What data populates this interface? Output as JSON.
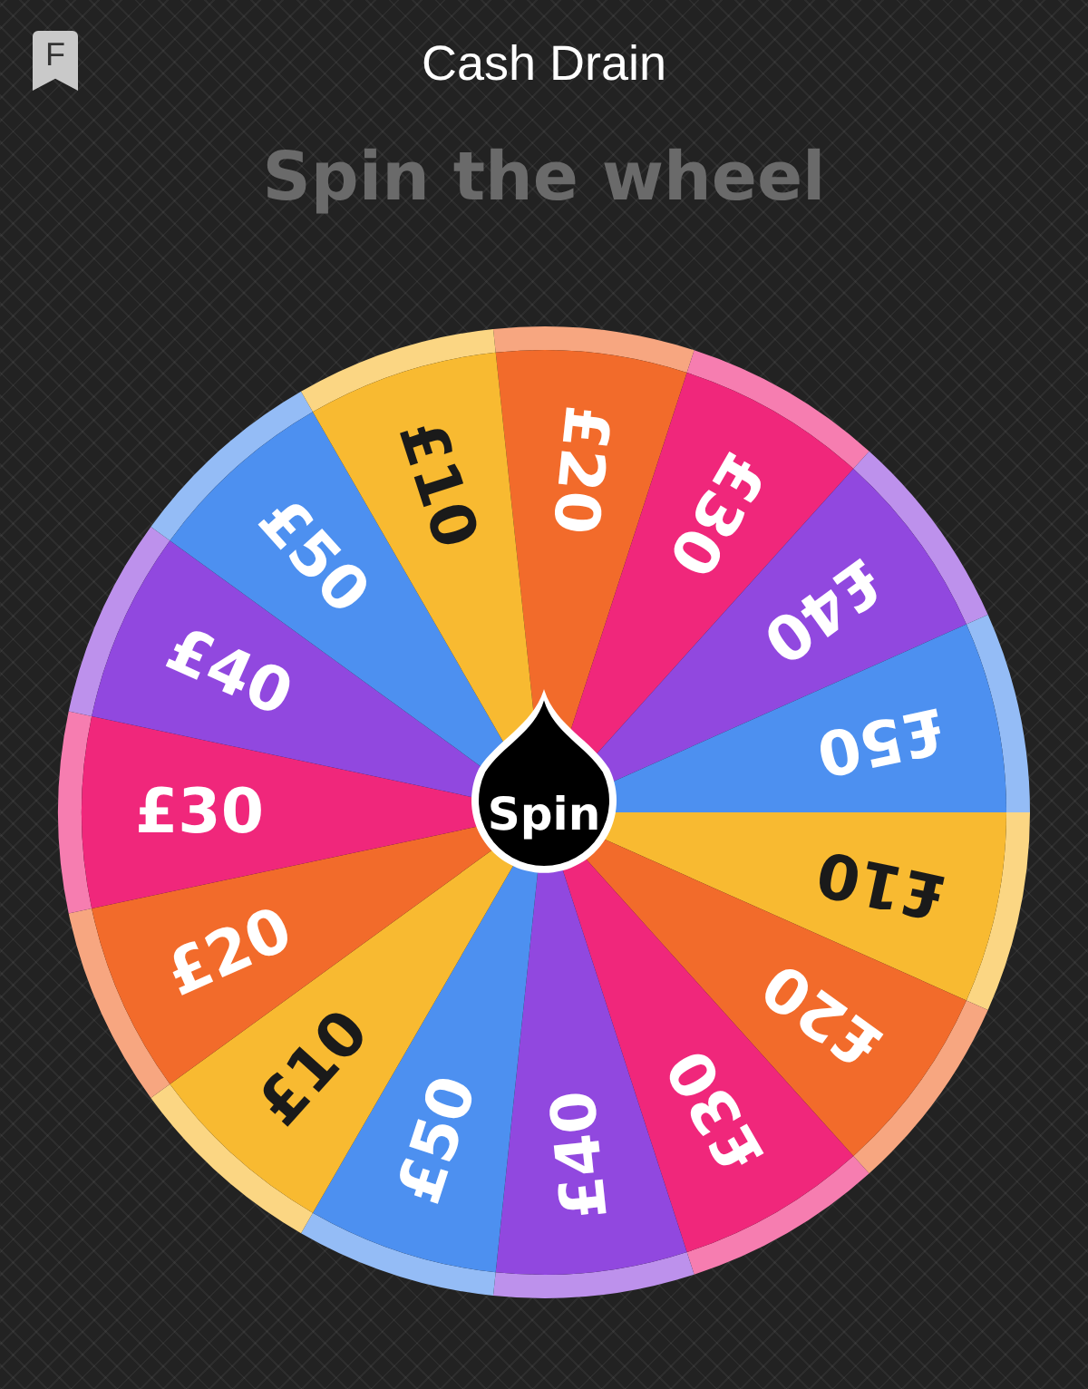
{
  "header": {
    "badge_letter": "F",
    "title": "Cash Drain"
  },
  "heading": "Spin the wheel",
  "wheel": {
    "spin_label": "Spin",
    "segments": [
      {
        "label": "£20",
        "color": "#f26b2b",
        "dark_text": false
      },
      {
        "label": "£30",
        "color": "#f0277b",
        "dark_text": false
      },
      {
        "label": "£40",
        "color": "#9148df",
        "dark_text": false
      },
      {
        "label": "£50",
        "color": "#4d90f0",
        "dark_text": false
      },
      {
        "label": "£10",
        "color": "#f8ba31",
        "dark_text": true
      },
      {
        "label": "£20",
        "color": "#f26b2b",
        "dark_text": false
      },
      {
        "label": "£30",
        "color": "#f0277b",
        "dark_text": false
      },
      {
        "label": "£40",
        "color": "#9148df",
        "dark_text": false
      },
      {
        "label": "£50",
        "color": "#4d90f0",
        "dark_text": false
      },
      {
        "label": "£10",
        "color": "#f8ba31",
        "dark_text": true
      },
      {
        "label": "£20",
        "color": "#f26b2b",
        "dark_text": false
      },
      {
        "label": "£30",
        "color": "#f0277b",
        "dark_text": false
      },
      {
        "label": "£40",
        "color": "#9148df",
        "dark_text": false
      },
      {
        "label": "£50",
        "color": "#4d90f0",
        "dark_text": false
      },
      {
        "label": "£10",
        "color": "#f8ba31",
        "dark_text": true
      }
    ]
  }
}
